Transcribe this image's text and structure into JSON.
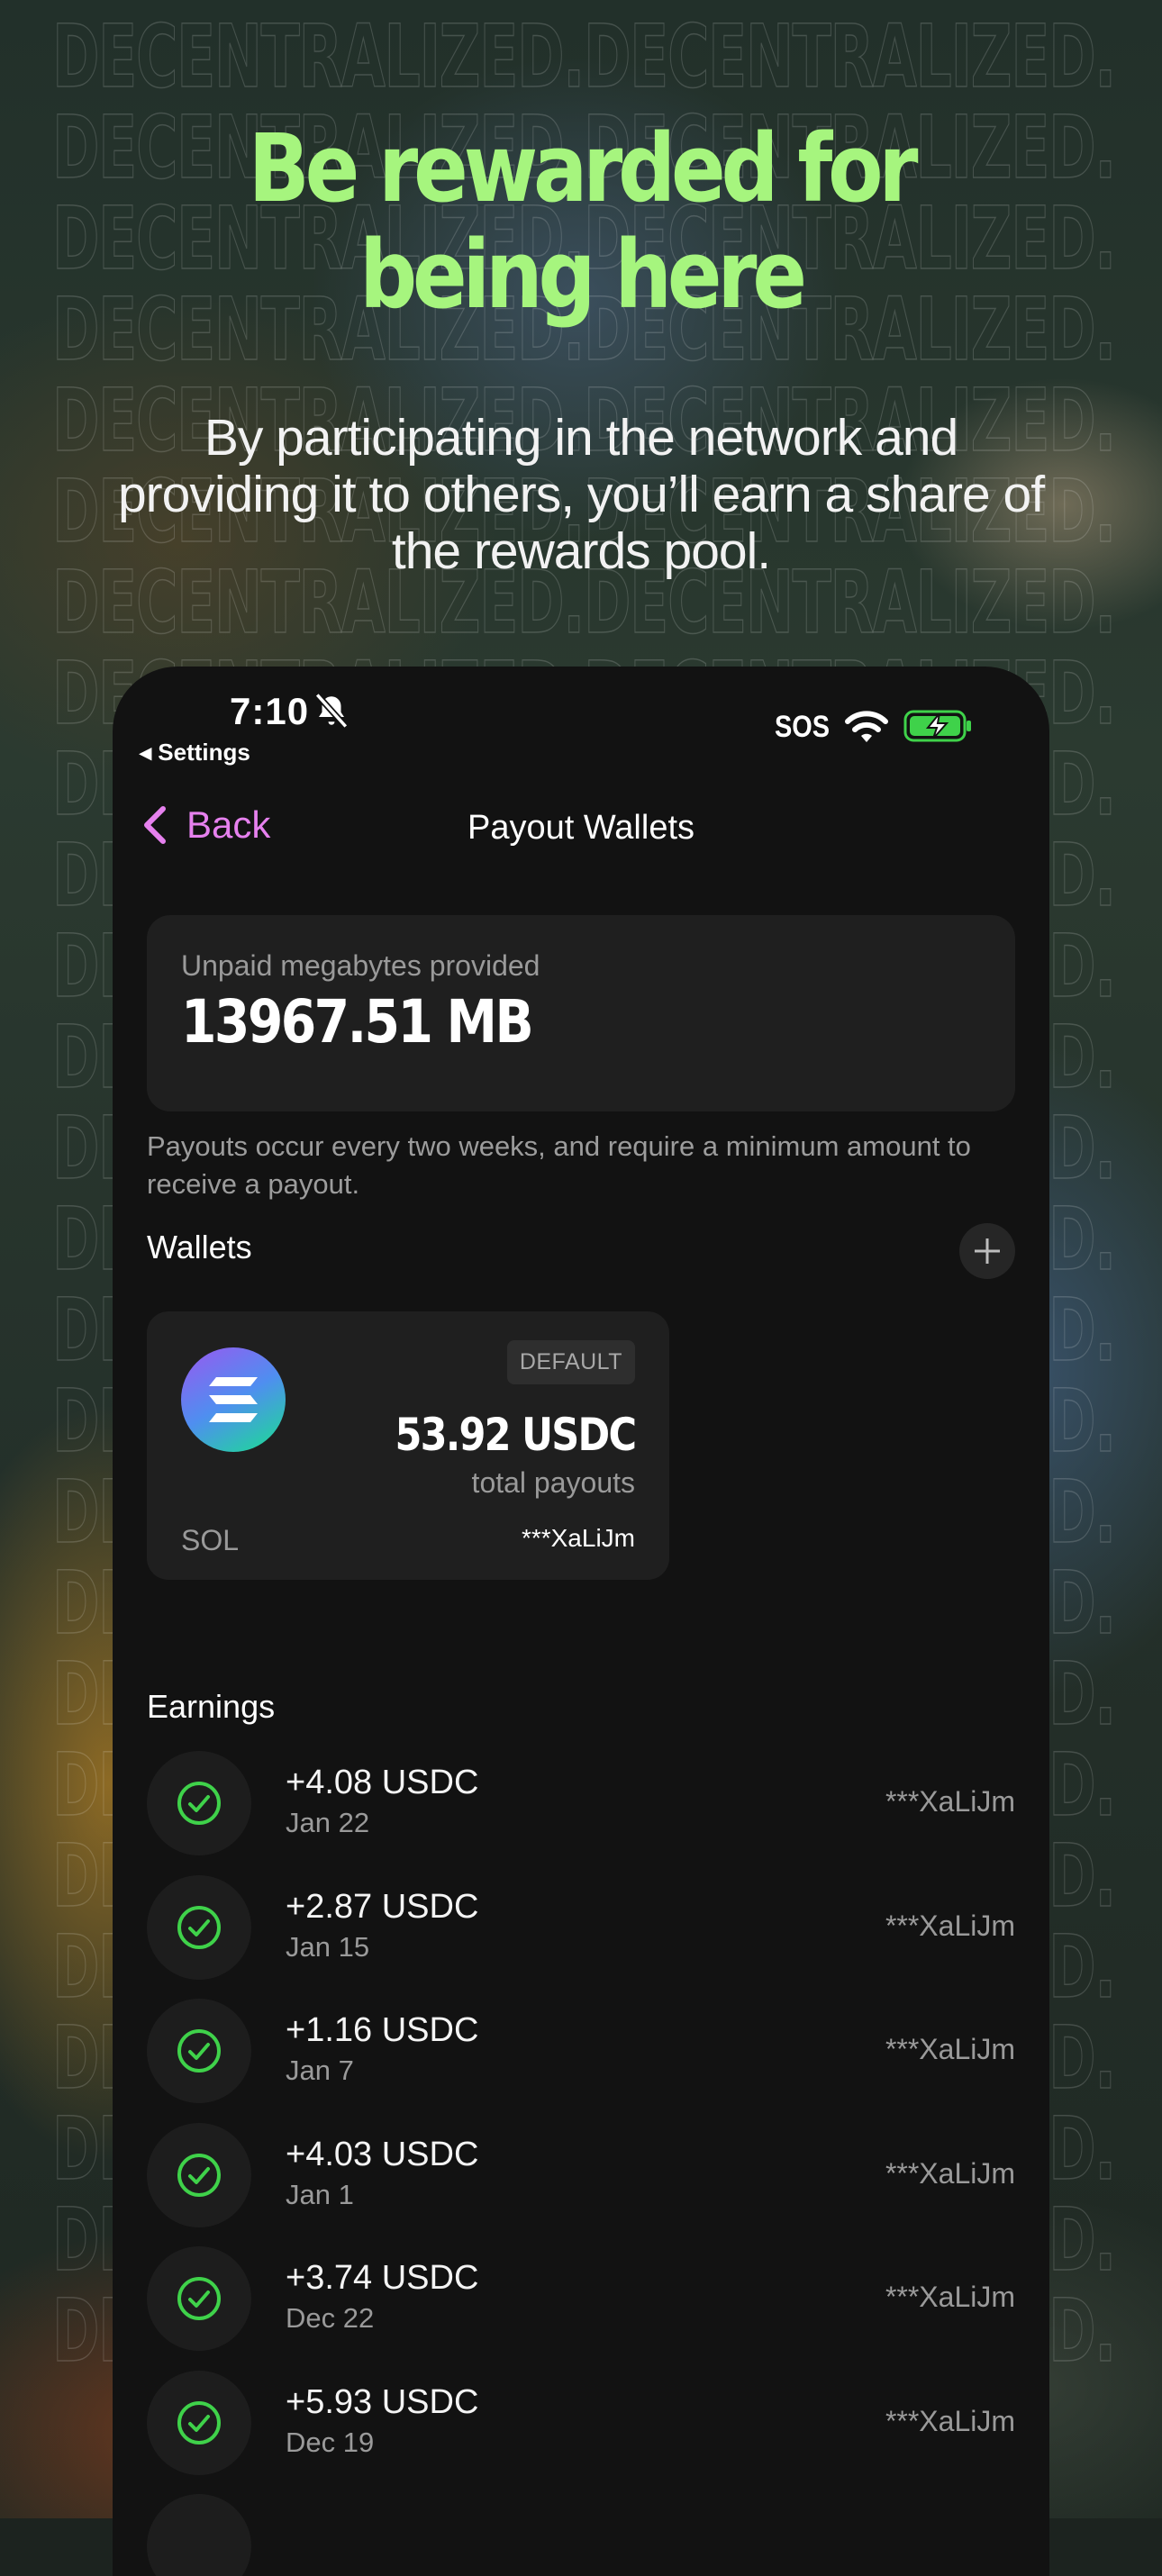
{
  "hero": {
    "title_line1": "Be rewarded for",
    "title_line2": "being here",
    "subtitle": "By participating in the network and providing it to others, you’ll earn a share of the rewards pool.",
    "watermark_text": "DECENTRALIZED."
  },
  "status_bar": {
    "time": "7:10",
    "back_app": "◂ Settings",
    "sos": "SOS"
  },
  "nav": {
    "back_label": "Back",
    "title": "Payout Wallets"
  },
  "unpaid": {
    "label": "Unpaid megabytes provided",
    "value": "13967.51 MB"
  },
  "note": "Payouts occur every two weeks, and require a minimum amount to receive a payout.",
  "wallets": {
    "heading": "Wallets",
    "items": [
      {
        "badge": "DEFAULT",
        "amount": "53.92 USDC",
        "caption": "total payouts",
        "chain": "SOL",
        "address": "***XaLiJm"
      }
    ]
  },
  "earnings": {
    "heading": "Earnings",
    "items": [
      {
        "amount": "+4.08 USDC",
        "date": "Jan 22",
        "address": "***XaLiJm"
      },
      {
        "amount": "+2.87 USDC",
        "date": "Jan 15",
        "address": "***XaLiJm"
      },
      {
        "amount": "+1.16 USDC",
        "date": "Jan 7",
        "address": "***XaLiJm"
      },
      {
        "amount": "+4.03 USDC",
        "date": "Jan 1",
        "address": "***XaLiJm"
      },
      {
        "amount": "+3.74 USDC",
        "date": "Dec 22",
        "address": "***XaLiJm"
      },
      {
        "amount": "+5.93 USDC",
        "date": "Dec 19",
        "address": "***XaLiJm"
      }
    ]
  },
  "colors": {
    "accent_green": "#a6f57e",
    "back_pink": "#e681ee",
    "check_green": "#3fd24a"
  },
  "icons": [
    "bell-slash-icon",
    "wifi-icon",
    "battery-charging-icon",
    "chevron-left-icon",
    "plus-icon",
    "solana-logo-icon",
    "check-circle-icon"
  ]
}
